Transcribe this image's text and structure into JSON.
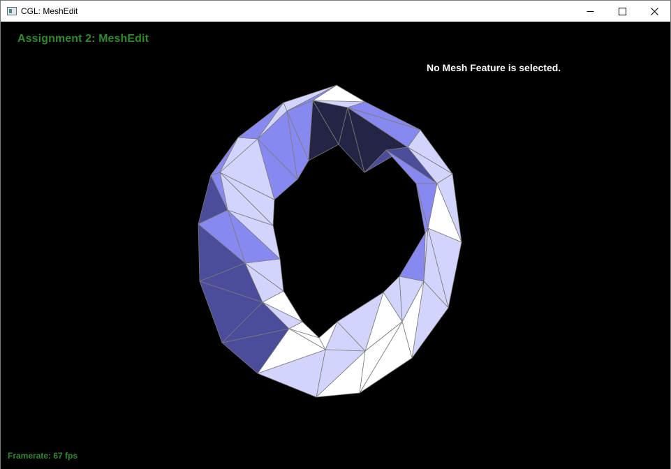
{
  "window": {
    "title": "CGL: MeshEdit",
    "controls": [
      "minimize-icon",
      "maximize-icon",
      "close-icon"
    ]
  },
  "viewport": {
    "background_color": "#000000",
    "hud_color": "#2f8a2f",
    "title": "Assignment 2: MeshEdit",
    "selection_status": "No Mesh Feature is selected.",
    "framerate": "Framerate: 67 fps"
  },
  "mesh": {
    "shape": "torus",
    "shading_colors": [
      "#ffffff",
      "#d3d4fb",
      "#8789f0",
      "#4c4d9a",
      "#242445"
    ],
    "edge_color": "#7a7a7a"
  }
}
